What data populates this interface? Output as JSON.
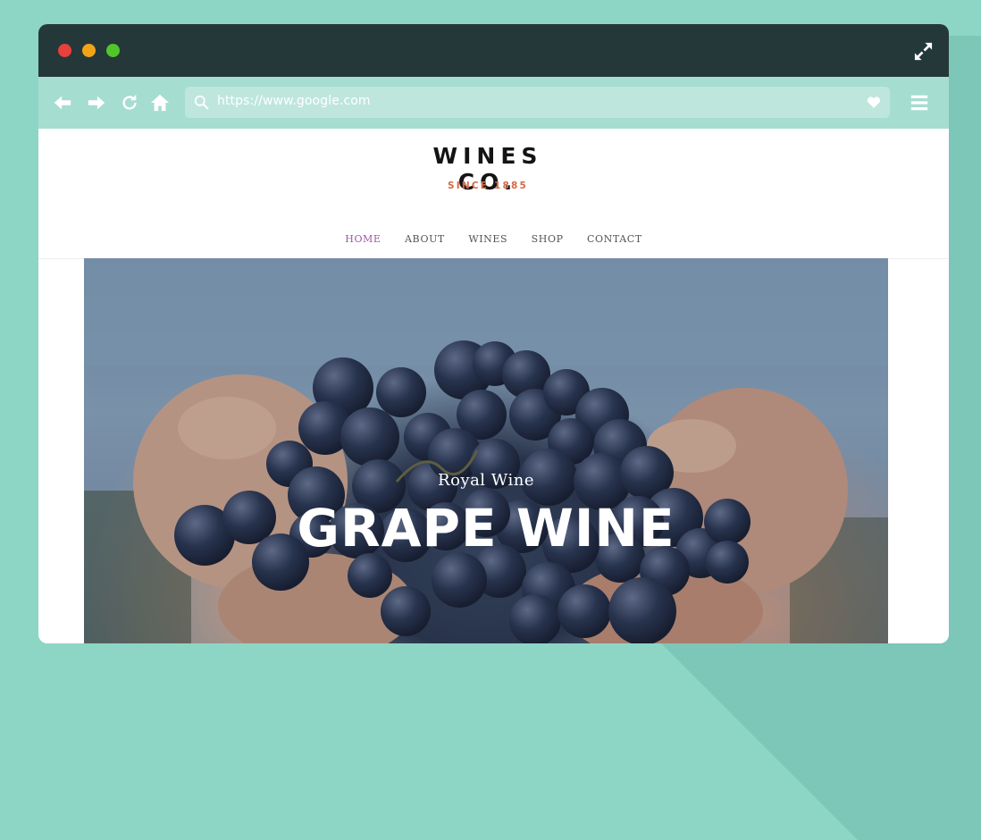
{
  "window": {
    "controls": [
      "close",
      "minimize",
      "maximize"
    ],
    "expand_icon": "expand-icon"
  },
  "toolbar": {
    "icons": [
      "back-arrow-icon",
      "forward-arrow-icon",
      "reload-icon",
      "home-icon",
      "hamburger-menu-icon"
    ],
    "url": "https://www.google.com",
    "search_icon": "search-icon",
    "favorite_icon": "heart-icon"
  },
  "site": {
    "logo_main": "WINES CO.",
    "logo_sub": "SINCE 1885",
    "menu": [
      {
        "label": "HOME",
        "active": true
      },
      {
        "label": "ABOUT",
        "active": false
      },
      {
        "label": "WINES",
        "active": false
      },
      {
        "label": "SHOP",
        "active": false
      },
      {
        "label": "CONTACT",
        "active": false
      }
    ]
  },
  "hero": {
    "subtitle": "Royal Wine",
    "title": "GRAPE WINE"
  },
  "colors": {
    "background": "#8dd6c6",
    "titlebar": "#253839",
    "toolbar": "#a6ddd1",
    "active_menu": "#a058a3",
    "logo_accent": "#d46a45"
  }
}
